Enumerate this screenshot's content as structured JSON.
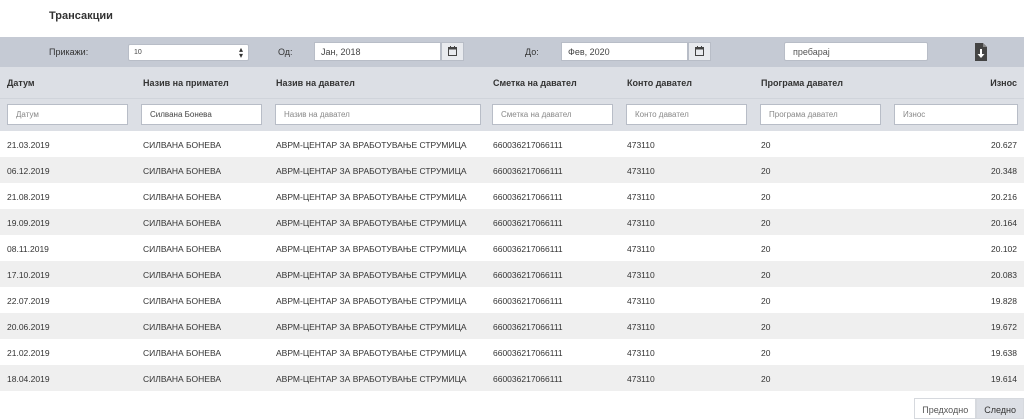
{
  "page": {
    "title": "Трансакции"
  },
  "filters": {
    "show_label": "Прикажи:",
    "show_value": "10",
    "from_label": "Од:",
    "from_value": "Јан, 2018",
    "to_label": "До:",
    "to_value": "Фев, 2020",
    "search_placeholder": "пребарај",
    "calendar_icon": "calendar-icon",
    "download_icon": "download-file-icon"
  },
  "table": {
    "columns": [
      "Датум",
      "Назив на примател",
      "Назив на давател",
      "Сметка на давател",
      "Конто давател",
      "Програма давател",
      "Износ"
    ],
    "column_filters": [
      "Датум",
      "Силвана Бонева",
      "Назив на давател",
      "Сметка на давател",
      "Конто давател",
      "Програма давател",
      "Износ"
    ],
    "rows": [
      [
        "21.03.2019",
        "СИЛВАНА БОНЕВА",
        "АВРМ-ЦЕНТАР ЗА ВРАБОТУВАЊЕ СТРУМИЦА",
        "660036217066111",
        "473110",
        "20",
        "20.627"
      ],
      [
        "06.12.2019",
        "СИЛВАНА БОНЕВА",
        "АВРМ-ЦЕНТАР ЗА ВРАБОТУВАЊЕ СТРУМИЦА",
        "660036217066111",
        "473110",
        "20",
        "20.348"
      ],
      [
        "21.08.2019",
        "СИЛВАНА БОНЕВА",
        "АВРМ-ЦЕНТАР ЗА ВРАБОТУВАЊЕ СТРУМИЦА",
        "660036217066111",
        "473110",
        "20",
        "20.216"
      ],
      [
        "19.09.2019",
        "СИЛВАНА БОНЕВА",
        "АВРМ-ЦЕНТАР ЗА ВРАБОТУВАЊЕ СТРУМИЦА",
        "660036217066111",
        "473110",
        "20",
        "20.164"
      ],
      [
        "08.11.2019",
        "СИЛВАНА БОНЕВА",
        "АВРМ-ЦЕНТАР ЗА ВРАБОТУВАЊЕ СТРУМИЦА",
        "660036217066111",
        "473110",
        "20",
        "20.102"
      ],
      [
        "17.10.2019",
        "СИЛВАНА БОНЕВА",
        "АВРМ-ЦЕНТАР ЗА ВРАБОТУВАЊЕ СТРУМИЦА",
        "660036217066111",
        "473110",
        "20",
        "20.083"
      ],
      [
        "22.07.2019",
        "СИЛВАНА БОНЕВА",
        "АВРМ-ЦЕНТАР ЗА ВРАБОТУВАЊЕ СТРУМИЦА",
        "660036217066111",
        "473110",
        "20",
        "19.828"
      ],
      [
        "20.06.2019",
        "СИЛВАНА БОНЕВА",
        "АВРМ-ЦЕНТАР ЗА ВРАБОТУВАЊЕ СТРУМИЦА",
        "660036217066111",
        "473110",
        "20",
        "19.672"
      ],
      [
        "21.02.2019",
        "СИЛВАНА БОНЕВА",
        "АВРМ-ЦЕНТАР ЗА ВРАБОТУВАЊЕ СТРУМИЦА",
        "660036217066111",
        "473110",
        "20",
        "19.638"
      ],
      [
        "18.04.2019",
        "СИЛВАНА БОНЕВА",
        "АВРМ-ЦЕНТАР ЗА ВРАБОТУВАЊЕ СТРУМИЦА",
        "660036217066111",
        "473110",
        "20",
        "19.614"
      ]
    ]
  },
  "pagination": {
    "prev_label": "Предходно",
    "next_label": "Следно"
  },
  "colors": {
    "filterbar": "#c5cad4",
    "header": "#dcdfe5",
    "row_alt": "#efefef"
  }
}
